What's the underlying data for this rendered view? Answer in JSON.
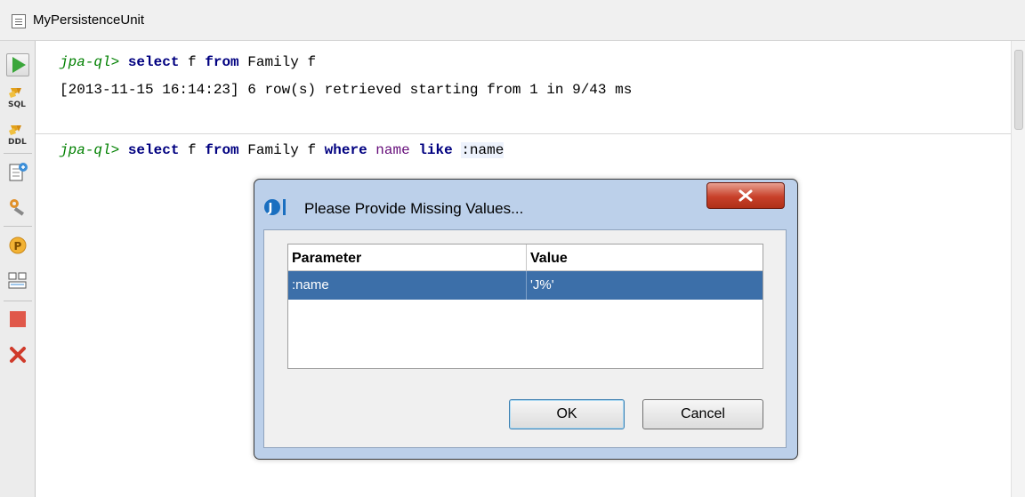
{
  "window": {
    "title": "MyPersistenceUnit"
  },
  "toolbar": {
    "items": [
      "run-icon",
      "sql-icon",
      "ddl-icon",
      "export-icon",
      "settings-icon",
      "parameters-icon",
      "layout-icon",
      "stop-icon",
      "close-icon"
    ]
  },
  "console": {
    "line1": {
      "prompt": "jpa-ql>",
      "kw1": "select",
      "t1": " f ",
      "kw2": "from",
      "t2": " Family f"
    },
    "line2": {
      "result": "[2013-11-15 16:14:23] 6 row(s) retrieved starting from 1 in 9/43 ms"
    },
    "line3": {
      "prompt": "jpa-ql>",
      "kw1": "select",
      "t1": " f ",
      "kw2": "from",
      "t2": " Family f ",
      "kw3": "where",
      "t3": " ",
      "name_word": "name",
      "t4": " ",
      "kw4": "like",
      "t5": " ",
      "param": ":name"
    }
  },
  "dialog": {
    "title": "Please Provide Missing Values...",
    "table": {
      "columns": [
        "Parameter",
        "Value"
      ],
      "rows": [
        {
          "parameter": ":name",
          "value": "'J%'"
        }
      ]
    },
    "ok_label": "OK",
    "cancel_label": "Cancel"
  },
  "colors": {
    "prompt": "#008000",
    "keyword": "#000080",
    "selection": "#3c6fa9",
    "stop": "#e0584a",
    "close": "#d03a2a",
    "run": "#3aa63a"
  }
}
